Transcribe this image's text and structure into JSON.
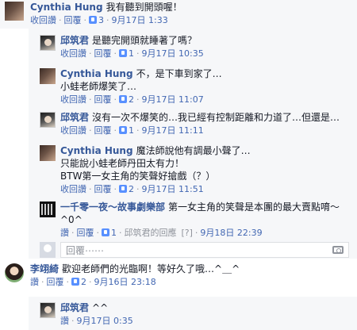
{
  "comments": [
    {
      "name": "Cynthia Hung",
      "text": "我有聽到開頭喔！",
      "reply": "收回讚",
      "replyb": "回覆",
      "likes": "3",
      "date": "9月17日 1:33"
    },
    {
      "name": "邱筑君",
      "text": "是聽完開頭就睡著了嗎？",
      "reply": "收回讚",
      "replyb": "回覆",
      "likes": "1",
      "date": "9月17日 10:35"
    },
    {
      "name": "Cynthia Hung",
      "text": "不，是下車到家了…",
      "text2": "小蛙老師爆笑了…",
      "reply": "收回讚",
      "replyb": "回覆",
      "likes": "2",
      "date": "9月17日 11:07"
    },
    {
      "name": "邱筑君",
      "text": "沒有一次不爆笑的…我已經有控制距離和力道了…但還是…",
      "reply": "收回讚",
      "replyb": "回覆",
      "likes": "1",
      "date": "9月17日 11:11"
    },
    {
      "name": "Cynthia Hung",
      "text": "魔法師說他有調最小聲了…",
      "text2": "只能說小蛙老師丹田太有力！",
      "text3": "BTW第一女主角的笑聲好搶戲（？）",
      "reply": "收回讚",
      "replyb": "回覆",
      "likes": "2",
      "date": "9月17日 11:51"
    },
    {
      "name": "一千零一夜～故事劇樂部",
      "text": "第一女主角的笑聲是本團的最大賣點唷～",
      "text2": "^0^",
      "reply": "讚",
      "replyb": "回覆",
      "likes": "1",
      "by": "邱筑君的回應",
      "edited": "[?]",
      "date": "9月18日 22:39"
    },
    {
      "name": "李翊綺",
      "text": "歡迎老師們的光臨啊！等好久了哦…^＿^",
      "reply": "讚",
      "replyb": "回覆",
      "likes": "2",
      "date": "9月16日 23:18"
    },
    {
      "name": "邱筑君",
      "text": "^^",
      "reply": "讚",
      "date": "9月17日 0:35"
    }
  ],
  "reply_box": {
    "placeholder": "回覆⋯⋯"
  }
}
